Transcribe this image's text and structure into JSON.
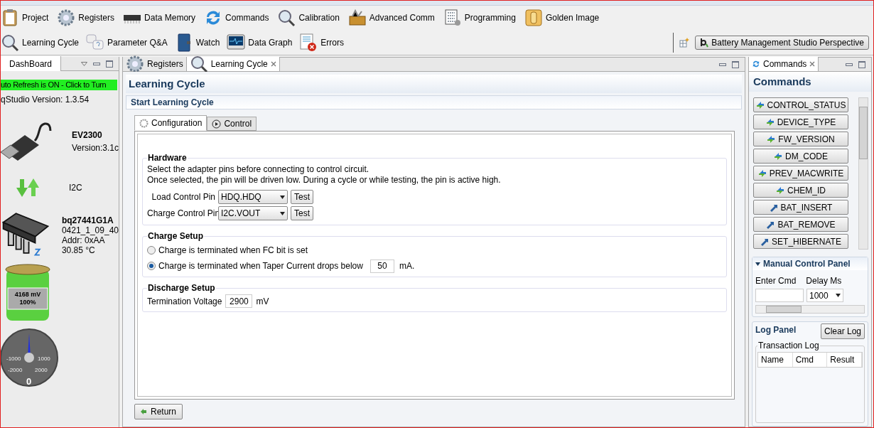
{
  "toolbar": {
    "row_1": [
      {
        "label": "Project"
      },
      {
        "label": "Registers"
      },
      {
        "label": "Data Memory"
      },
      {
        "label": "Commands"
      },
      {
        "label": "Calibration"
      },
      {
        "label": "Advanced Comm"
      },
      {
        "label": "Programming"
      },
      {
        "label": "Golden Image"
      }
    ],
    "row_2": [
      {
        "label": "Learning Cycle"
      },
      {
        "label": "Parameter Q&A"
      },
      {
        "label": "Watch"
      },
      {
        "label": "Data Graph"
      },
      {
        "label": "Errors"
      }
    ],
    "perspective": "Battery Management Studio Perspective"
  },
  "dashboard": {
    "tab": "DashBoard",
    "auto_refresh": "uto Refresh is ON - Click to Turn",
    "version": "qStudio Version:  1.3.54",
    "adapter": {
      "name": "EV2300",
      "version": "Version:3.1c"
    },
    "protocol": "I2C",
    "gauge": {
      "name": "bq27441G1A",
      "lines": [
        "0421_1_09_40",
        "Addr: 0xAA",
        "30.85 °C"
      ]
    },
    "battery": {
      "voltage": "4168 mV",
      "percent": "100%"
    },
    "meter": {
      "ticks": [
        "-1000",
        "1000",
        "-2000",
        "2000"
      ],
      "reading": "0"
    }
  },
  "editor": {
    "tabs": [
      {
        "label": "Registers",
        "selected": false
      },
      {
        "label": "Learning Cycle",
        "selected": true
      }
    ],
    "title": "Learning Cycle",
    "section": "Start Learning Cycle",
    "inner_tabs": [
      {
        "label": "Configuration",
        "selected": true
      },
      {
        "label": "Control",
        "selected": false
      }
    ],
    "hardware": {
      "title": "Hardware",
      "lines": [
        "Select the adapter pins before connecting to control circuit.",
        "Once selected, the pin will be driven low. During a cycle or while testing, the pin is active high."
      ],
      "pins": [
        {
          "label": "Load Control Pin",
          "value": "HDQ.HDQ",
          "button": "Test"
        },
        {
          "label": "Charge Control Pin",
          "value": "I2C.VOUT",
          "button": "Test"
        }
      ]
    },
    "charge": {
      "title": "Charge Setup",
      "options": [
        {
          "label": "Charge is terminated when FC bit is set",
          "selected": false
        },
        {
          "label": "Charge is terminated when Taper Current drops below",
          "selected": true,
          "value": "50",
          "unit": "mA."
        }
      ]
    },
    "discharge": {
      "title": "Discharge Setup",
      "label": "Termination Voltage",
      "value": "2900",
      "unit": "mV"
    },
    "return": "Return"
  },
  "commands": {
    "tab": "Commands",
    "title": "Commands",
    "buttons": [
      {
        "label": "CONTROL_STATUS",
        "kind": "read"
      },
      {
        "label": "DEVICE_TYPE",
        "kind": "read"
      },
      {
        "label": "FW_VERSION",
        "kind": "read"
      },
      {
        "label": "DM_CODE",
        "kind": "read"
      },
      {
        "label": "PREV_MACWRITE",
        "kind": "read"
      },
      {
        "label": "CHEM_ID",
        "kind": "read"
      },
      {
        "label": "BAT_INSERT",
        "kind": "write"
      },
      {
        "label": "BAT_REMOVE",
        "kind": "write"
      },
      {
        "label": "SET_HIBERNATE",
        "kind": "write"
      }
    ],
    "manual": {
      "title": "Manual Control Panel",
      "expanded": true,
      "enter_cmd": "Enter Cmd",
      "delay": "Delay Ms",
      "delay_value": "1000"
    },
    "log": {
      "title": "Log Panel",
      "clear": "Clear Log",
      "group": "Transaction Log",
      "columns": [
        "Name",
        "Cmd",
        "Result"
      ]
    }
  }
}
